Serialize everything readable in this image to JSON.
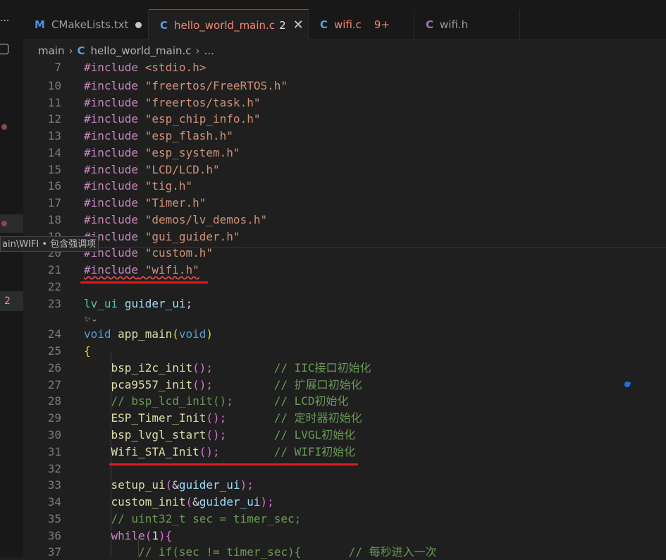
{
  "activity": {
    "dots": "···",
    "error_badge": "2"
  },
  "hover_tip": "ain\\WIFI • 包含强调项",
  "tabs": [
    {
      "icon": "M",
      "name": "CMakeLists.txt",
      "modified": true
    },
    {
      "icon": "C",
      "name": "hello_world_main.c",
      "count": "2",
      "close": "✕"
    },
    {
      "icon": "C",
      "name": "wifi.c",
      "badge": "9+"
    },
    {
      "icon": "C",
      "name": "wifi.h"
    }
  ],
  "breadcrumb": {
    "folder": "main",
    "icon": "C",
    "file": "hello_world_main.c",
    "more": "...",
    "sep": "›"
  },
  "copilot_hint": "✨︎⌄",
  "lines": {
    "l7": {
      "n": "7",
      "kw": "#include",
      "str": "<stdio.h>"
    },
    "l10": {
      "n": "10",
      "kw": "#include",
      "str": "\"freertos/FreeRTOS.h\""
    },
    "l11": {
      "n": "11",
      "kw": "#include",
      "str": "\"freertos/task.h\""
    },
    "l12": {
      "n": "12",
      "kw": "#include",
      "str": "\"esp_chip_info.h\""
    },
    "l13": {
      "n": "13",
      "kw": "#include",
      "str": "\"esp_flash.h\""
    },
    "l14": {
      "n": "14",
      "kw": "#include",
      "str": "\"esp_system.h\""
    },
    "l15": {
      "n": "15",
      "kw": "#include",
      "str": "\"LCD/LCD.h\""
    },
    "l16": {
      "n": "16",
      "kw": "#include",
      "str": "\"tig.h\""
    },
    "l17": {
      "n": "17",
      "kw": "#include",
      "str": "\"Timer.h\""
    },
    "l18": {
      "n": "18",
      "kw": "#include",
      "str": "\"demos/lv_demos.h\""
    },
    "l19": {
      "n": "19",
      "kw": "#include",
      "str": "\"gui_guider.h\""
    },
    "l20": {
      "n": "20",
      "kw": "#include",
      "str": "\"custom.h\""
    },
    "l21": {
      "n": "21",
      "kw": "#include",
      "str": "\"wifi.h\""
    },
    "l22": {
      "n": "22"
    },
    "l23": {
      "n": "23",
      "type": "lv_ui",
      "var": "guider_ui",
      "semi": ";"
    },
    "l24": {
      "n": "24",
      "key": "void",
      "fn": "app_main",
      "open": "(",
      "arg": "void",
      "close": ")"
    },
    "l25": {
      "n": "25",
      "brace": "{"
    },
    "l26": {
      "n": "26",
      "fn": "bsp_i2c_init",
      "parens": "();",
      "cm": "// IIC接口初始化"
    },
    "l27": {
      "n": "27",
      "fn": "pca9557_init",
      "parens": "();",
      "cm": "// 扩展口初始化"
    },
    "l28": {
      "n": "28",
      "cm1": "// bsp_lcd_init();",
      "cm": "// LCD初始化"
    },
    "l29": {
      "n": "29",
      "fn": "ESP_Timer_Init",
      "parens": "();",
      "cm": "// 定时器初始化"
    },
    "l30": {
      "n": "30",
      "fn": "bsp_lvgl_start",
      "parens": "();",
      "cm": "// LVGL初始化"
    },
    "l31": {
      "n": "31",
      "fn": "Wifi_STA_Init",
      "parens": "();",
      "cm": "// WIFI初始化"
    },
    "l32": {
      "n": "32"
    },
    "l33": {
      "n": "33",
      "fn": "setup_ui",
      "open": "(",
      "amp": "&",
      "var": "guider_ui",
      "close": ");"
    },
    "l34": {
      "n": "34",
      "fn": "custom_init",
      "open": "(",
      "amp": "&",
      "var": "guider_ui",
      "close": ");"
    },
    "l35": {
      "n": "35",
      "cm": "// uint32_t sec = timer_sec;"
    },
    "l36": {
      "n": "36",
      "kw": "while",
      "open": "(",
      "num": "1",
      "close": "){"
    },
    "l37": {
      "n": "37",
      "cm": "// if(sec != timer_sec){       // 每秒进入一次"
    }
  }
}
